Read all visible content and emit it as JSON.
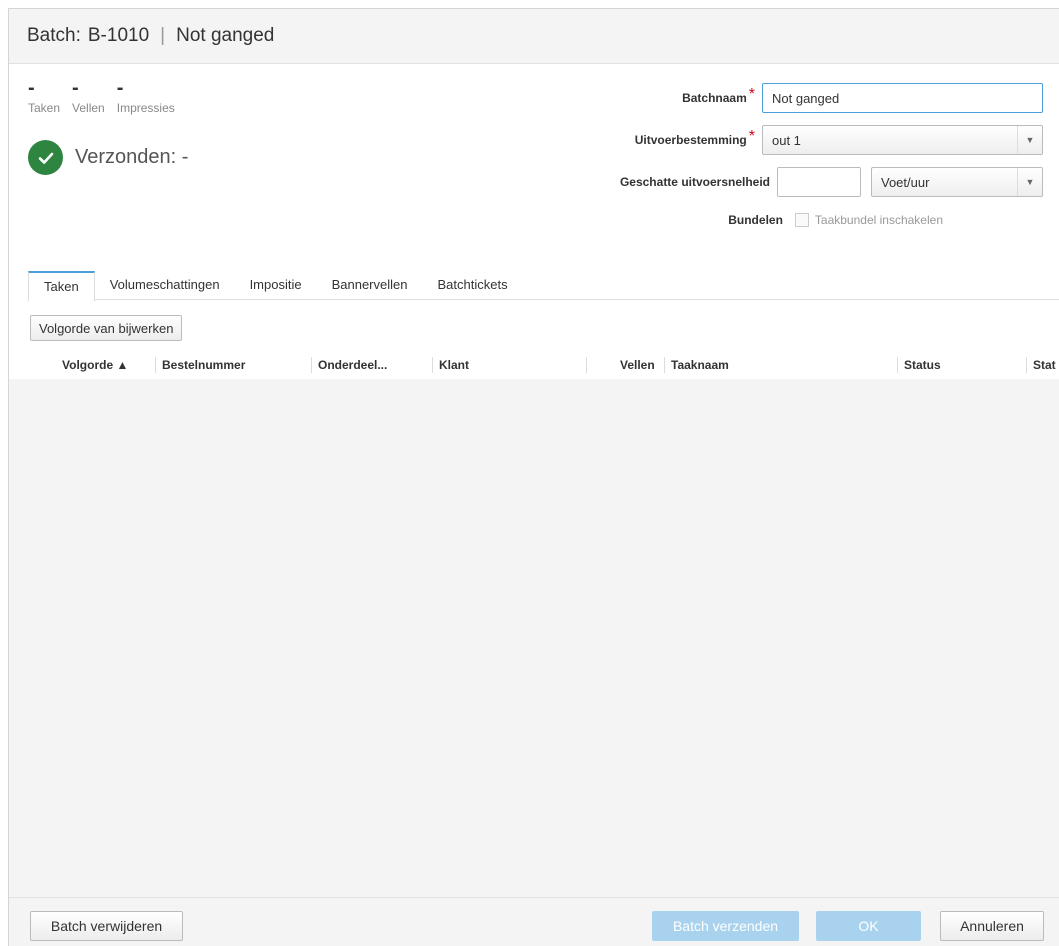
{
  "title": {
    "batch_label": "Batch:",
    "batch_id": "B-1010",
    "batch_name": "Not ganged"
  },
  "stats": [
    {
      "value": "-",
      "label": "Taken"
    },
    {
      "value": "-",
      "label": "Vellen"
    },
    {
      "value": "-",
      "label": "Impressies"
    }
  ],
  "status": {
    "text": "Verzonden: -",
    "color": "#2e8540"
  },
  "form": {
    "batchnaam_label": "Batchnaam",
    "batchnaam_value": "Not ganged",
    "uitvoer_label": "Uitvoerbestemming",
    "uitvoer_value": "out 1",
    "snelheid_label": "Geschatte uitvoersnelheid",
    "snelheid_value": "",
    "snelheid_unit": "Voet/uur",
    "bundelen_label": "Bundelen",
    "bundelen_checkbox_label": "Taakbundel inschakelen"
  },
  "tabs": [
    "Taken",
    "Volumeschattingen",
    "Impositie",
    "Bannervellen",
    "Batchtickets"
  ],
  "toolbar": {
    "update_order_label": "Volgorde van bijwerken"
  },
  "columns": {
    "volgorde": "Volgorde ▲",
    "bestelnummer": "Bestelnummer",
    "onderdeel": "Onderdeel...",
    "klant": "Klant",
    "vellen": "Vellen",
    "taaknaam": "Taaknaam",
    "status": "Status",
    "stat": "Stat"
  },
  "footer": {
    "delete_label": "Batch verwijderen",
    "send_label": "Batch verzenden",
    "ok_label": "OK",
    "cancel_label": "Annuleren"
  },
  "colors": {
    "accent": "#4a9fd8",
    "required": "#d0021b",
    "primary_disabled": "#a8d2ee"
  }
}
